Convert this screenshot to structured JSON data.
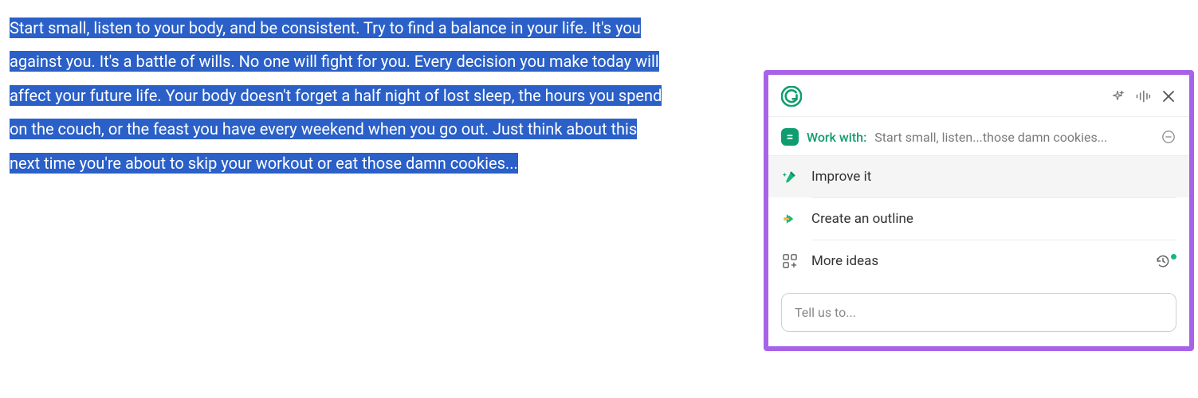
{
  "document": {
    "selected_text": "Start small, listen to your body, and be consistent. Try to find a balance in your life. It's you against you. It's a battle of wills. No one will fight for you. Every decision you make today will affect your future life. Your body doesn't forget a half night of lost sleep, the hours you spend on the couch, or the feast you have every weekend when you go out. Just think about this next time you're about to skip your workout or eat those damn cookies..."
  },
  "panel": {
    "work_with": {
      "label": "Work with:",
      "text": "Start small, listen...those damn cookies..."
    },
    "options": [
      {
        "icon": "pencil-sparkle-icon",
        "label": "Improve it"
      },
      {
        "icon": "arrow-right-icon",
        "label": "Create an outline"
      },
      {
        "icon": "grid-plus-icon",
        "label": "More ideas"
      }
    ],
    "input": {
      "placeholder": "Tell us to..."
    }
  }
}
